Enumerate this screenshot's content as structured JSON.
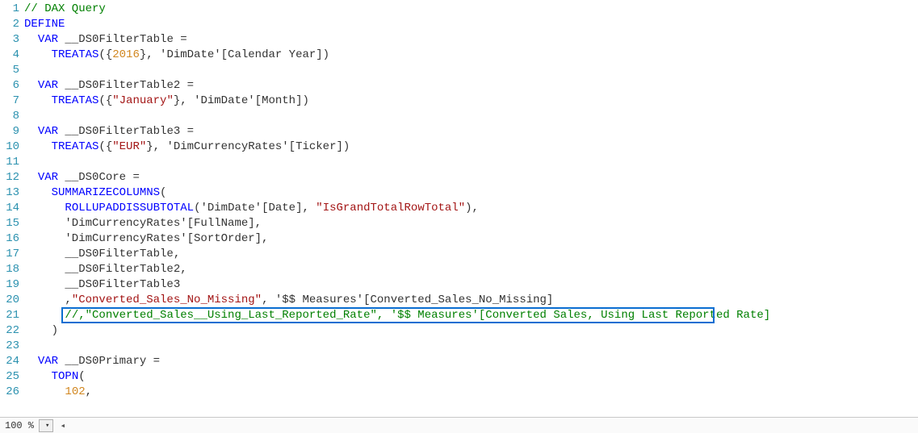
{
  "code": {
    "lines": [
      {
        "n": 1,
        "segs": [
          {
            "cls": "c-comment",
            "t": "// DAX Query"
          }
        ]
      },
      {
        "n": 2,
        "segs": [
          {
            "cls": "c-keyword",
            "t": "DEFINE"
          }
        ]
      },
      {
        "n": 3,
        "segs": [
          {
            "cls": "c-plain",
            "t": "  "
          },
          {
            "cls": "c-keyword",
            "t": "VAR"
          },
          {
            "cls": "c-plain",
            "t": " __DS0FilterTable ="
          }
        ]
      },
      {
        "n": 4,
        "segs": [
          {
            "cls": "c-plain",
            "t": "    "
          },
          {
            "cls": "c-keyword",
            "t": "TREATAS"
          },
          {
            "cls": "c-plain",
            "t": "({"
          },
          {
            "cls": "c-number",
            "t": "2016"
          },
          {
            "cls": "c-plain",
            "t": "}, 'DimDate'[Calendar Year])"
          }
        ]
      },
      {
        "n": 5,
        "segs": [
          {
            "cls": "c-plain",
            "t": ""
          }
        ]
      },
      {
        "n": 6,
        "segs": [
          {
            "cls": "c-plain",
            "t": "  "
          },
          {
            "cls": "c-keyword",
            "t": "VAR"
          },
          {
            "cls": "c-plain",
            "t": " __DS0FilterTable2 ="
          }
        ]
      },
      {
        "n": 7,
        "segs": [
          {
            "cls": "c-plain",
            "t": "    "
          },
          {
            "cls": "c-keyword",
            "t": "TREATAS"
          },
          {
            "cls": "c-plain",
            "t": "({"
          },
          {
            "cls": "c-string",
            "t": "\"January\""
          },
          {
            "cls": "c-plain",
            "t": "}, 'DimDate'[Month])"
          }
        ]
      },
      {
        "n": 8,
        "segs": [
          {
            "cls": "c-plain",
            "t": ""
          }
        ]
      },
      {
        "n": 9,
        "segs": [
          {
            "cls": "c-plain",
            "t": "  "
          },
          {
            "cls": "c-keyword",
            "t": "VAR"
          },
          {
            "cls": "c-plain",
            "t": " __DS0FilterTable3 ="
          }
        ]
      },
      {
        "n": 10,
        "segs": [
          {
            "cls": "c-plain",
            "t": "    "
          },
          {
            "cls": "c-keyword",
            "t": "TREATAS"
          },
          {
            "cls": "c-plain",
            "t": "({"
          },
          {
            "cls": "c-string",
            "t": "\"EUR\""
          },
          {
            "cls": "c-plain",
            "t": "}, 'DimCurrencyRates'[Ticker])"
          }
        ]
      },
      {
        "n": 11,
        "segs": [
          {
            "cls": "c-plain",
            "t": ""
          }
        ]
      },
      {
        "n": 12,
        "segs": [
          {
            "cls": "c-plain",
            "t": "  "
          },
          {
            "cls": "c-keyword",
            "t": "VAR"
          },
          {
            "cls": "c-plain",
            "t": " __DS0Core ="
          }
        ]
      },
      {
        "n": 13,
        "segs": [
          {
            "cls": "c-plain",
            "t": "    "
          },
          {
            "cls": "c-keyword",
            "t": "SUMMARIZECOLUMNS"
          },
          {
            "cls": "c-plain",
            "t": "("
          }
        ]
      },
      {
        "n": 14,
        "segs": [
          {
            "cls": "c-plain",
            "t": "      "
          },
          {
            "cls": "c-keyword",
            "t": "ROLLUPADDISSUBTOTAL"
          },
          {
            "cls": "c-plain",
            "t": "('DimDate'[Date], "
          },
          {
            "cls": "c-string",
            "t": "\"IsGrandTotalRowTotal\""
          },
          {
            "cls": "c-plain",
            "t": "),"
          }
        ]
      },
      {
        "n": 15,
        "segs": [
          {
            "cls": "c-plain",
            "t": "      'DimCurrencyRates'[FullName],"
          }
        ]
      },
      {
        "n": 16,
        "segs": [
          {
            "cls": "c-plain",
            "t": "      'DimCurrencyRates'[SortOrder],"
          }
        ]
      },
      {
        "n": 17,
        "segs": [
          {
            "cls": "c-plain",
            "t": "      __DS0FilterTable,"
          }
        ]
      },
      {
        "n": 18,
        "segs": [
          {
            "cls": "c-plain",
            "t": "      __DS0FilterTable2,"
          }
        ]
      },
      {
        "n": 19,
        "segs": [
          {
            "cls": "c-plain",
            "t": "      __DS0FilterTable3"
          }
        ]
      },
      {
        "n": 20,
        "segs": [
          {
            "cls": "c-plain",
            "t": "      ,"
          },
          {
            "cls": "c-string",
            "t": "\"Converted_Sales_No_Missing\""
          },
          {
            "cls": "c-plain",
            "t": ", '$$ Measures'[Converted_Sales_No_Missing]"
          }
        ]
      },
      {
        "n": 21,
        "segs": [
          {
            "cls": "c-plain",
            "t": "      "
          },
          {
            "cls": "c-commentcode",
            "t": "//,\"Converted_Sales__Using_Last_Reported_Rate\", '$$ Measures'[Converted Sales, Using Last Reported Rate]"
          }
        ]
      },
      {
        "n": 22,
        "segs": [
          {
            "cls": "c-plain",
            "t": "    )"
          }
        ]
      },
      {
        "n": 23,
        "segs": [
          {
            "cls": "c-plain",
            "t": ""
          }
        ]
      },
      {
        "n": 24,
        "segs": [
          {
            "cls": "c-plain",
            "t": "  "
          },
          {
            "cls": "c-keyword",
            "t": "VAR"
          },
          {
            "cls": "c-plain",
            "t": " __DS0Primary ="
          }
        ]
      },
      {
        "n": 25,
        "segs": [
          {
            "cls": "c-plain",
            "t": "    "
          },
          {
            "cls": "c-keyword",
            "t": "TOPN"
          },
          {
            "cls": "c-plain",
            "t": "("
          }
        ]
      },
      {
        "n": 26,
        "segs": [
          {
            "cls": "c-plain",
            "t": "      "
          },
          {
            "cls": "c-number",
            "t": "102"
          },
          {
            "cls": "c-plain",
            "t": ","
          }
        ]
      }
    ],
    "highlight_line": 21,
    "highlight_left_ch": 6,
    "highlight_width_ch": 105
  },
  "status": {
    "zoom": "100 %",
    "scroll_left_glyph": "◂"
  }
}
